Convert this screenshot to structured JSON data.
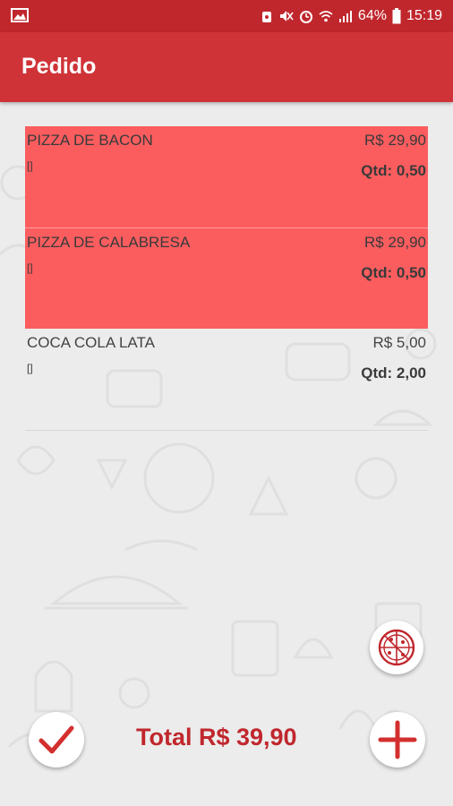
{
  "status_bar": {
    "battery": "64%",
    "time": "15:19"
  },
  "app_bar": {
    "title": "Pedido"
  },
  "order": {
    "items": [
      {
        "name": "PIZZA DE BACON",
        "price": "R$ 29,90",
        "notes": "[]",
        "qty": "Qtd: 0,50",
        "highlighted": true
      },
      {
        "name": "PIZZA DE CALABRESA",
        "price": "R$ 29,90",
        "notes": "[]",
        "qty": "Qtd: 0,50",
        "highlighted": true
      },
      {
        "name": "COCA COLA LATA",
        "price": "R$ 5,00",
        "notes": "[]",
        "qty": "Qtd: 2,00",
        "highlighted": false
      }
    ]
  },
  "footer": {
    "total": "Total R$ 39,90"
  },
  "icons": {
    "pizza": "pizza-icon",
    "confirm": "check-icon",
    "add": "plus-icon"
  },
  "colors": {
    "primary": "#cf3338",
    "primary_dark": "#c0272d",
    "highlight": "#fb5d5f",
    "background": "#ececec"
  }
}
